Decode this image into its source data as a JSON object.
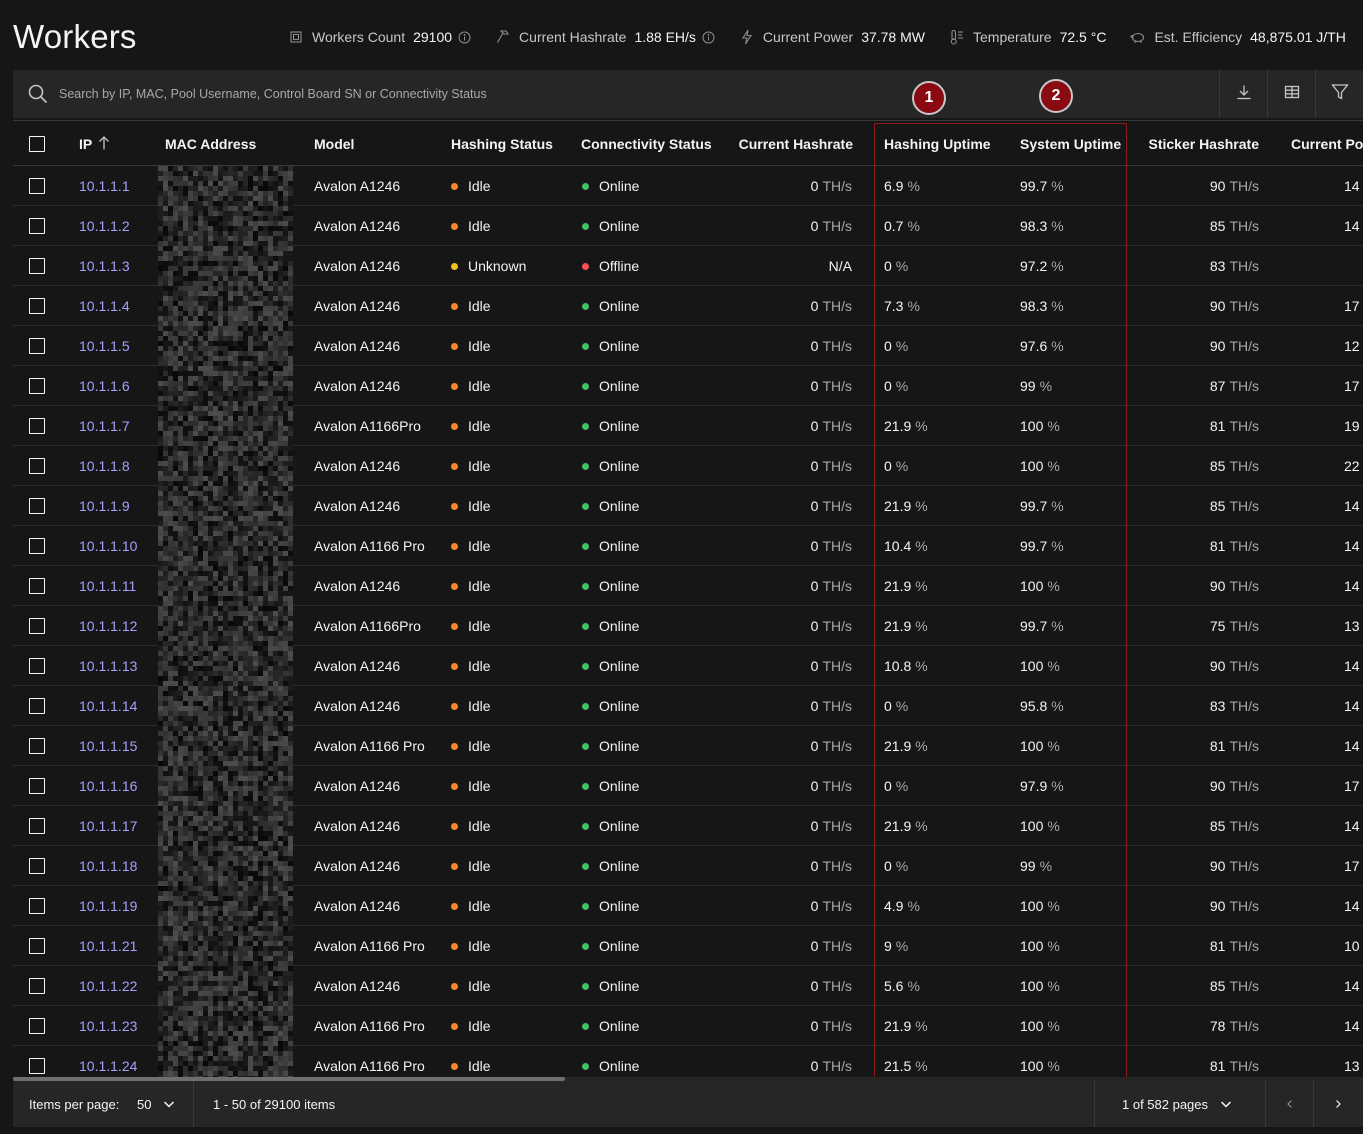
{
  "page": {
    "title": "Workers"
  },
  "stats": [
    {
      "icon": "chip-icon",
      "label": "Workers Count",
      "value": "29100",
      "info": true
    },
    {
      "icon": "hammer-icon",
      "label": "Current Hashrate",
      "value": "1.88 EH/s",
      "info": true
    },
    {
      "icon": "lightning-icon",
      "label": "Current Power",
      "value": "37.78 MW",
      "info": false
    },
    {
      "icon": "thermometer-icon",
      "label": "Temperature",
      "value": "72.5 °C",
      "info": false
    },
    {
      "icon": "piggy-bank-icon",
      "label": "Est. Efficiency",
      "value": "48,875.01 J/TH",
      "info": false
    }
  ],
  "search": {
    "placeholder": "Search by IP, MAC, Pool Username, Control Board SN or Connectivity Status"
  },
  "toolbar": {
    "icons": [
      "download-icon",
      "columns-icon",
      "filter-icon"
    ]
  },
  "columns": [
    "IP",
    "MAC Address",
    "Model",
    "Hashing Status",
    "Connectivity Status",
    "Current Hashrate",
    "Hashing Uptime",
    "System Uptime",
    "Sticker Hashrate",
    "Current Power"
  ],
  "sort": {
    "column": "IP",
    "direction": "ascending"
  },
  "annotations": {
    "marker1": "1",
    "marker2": "2"
  },
  "rows": [
    {
      "ip": "10.1.1.1",
      "model": "Avalon A1246",
      "hashing": "Idle",
      "conn": "Online",
      "hashrate": "0",
      "hashrate_unit": "TH/s",
      "hu": "6.9",
      "su": "99.7",
      "sticker": "90",
      "power": "14"
    },
    {
      "ip": "10.1.1.2",
      "model": "Avalon A1246",
      "hashing": "Idle",
      "conn": "Online",
      "hashrate": "0",
      "hashrate_unit": "TH/s",
      "hu": "0.7",
      "su": "98.3",
      "sticker": "85",
      "power": "14"
    },
    {
      "ip": "10.1.1.3",
      "model": "Avalon A1246",
      "hashing": "Unknown",
      "conn": "Offline",
      "hashrate": "N/A",
      "hashrate_unit": "",
      "hu": "0",
      "su": "97.2",
      "sticker": "83",
      "power": ""
    },
    {
      "ip": "10.1.1.4",
      "model": "Avalon A1246",
      "hashing": "Idle",
      "conn": "Online",
      "hashrate": "0",
      "hashrate_unit": "TH/s",
      "hu": "7.3",
      "su": "98.3",
      "sticker": "90",
      "power": "17"
    },
    {
      "ip": "10.1.1.5",
      "model": "Avalon A1246",
      "hashing": "Idle",
      "conn": "Online",
      "hashrate": "0",
      "hashrate_unit": "TH/s",
      "hu": "0",
      "su": "97.6",
      "sticker": "90",
      "power": "12"
    },
    {
      "ip": "10.1.1.6",
      "model": "Avalon A1246",
      "hashing": "Idle",
      "conn": "Online",
      "hashrate": "0",
      "hashrate_unit": "TH/s",
      "hu": "0",
      "su": "99",
      "sticker": "87",
      "power": "17"
    },
    {
      "ip": "10.1.1.7",
      "model": "Avalon A1166Pro",
      "hashing": "Idle",
      "conn": "Online",
      "hashrate": "0",
      "hashrate_unit": "TH/s",
      "hu": "21.9",
      "su": "100",
      "sticker": "81",
      "power": "19"
    },
    {
      "ip": "10.1.1.8",
      "model": "Avalon A1246",
      "hashing": "Idle",
      "conn": "Online",
      "hashrate": "0",
      "hashrate_unit": "TH/s",
      "hu": "0",
      "su": "100",
      "sticker": "85",
      "power": "22"
    },
    {
      "ip": "10.1.1.9",
      "model": "Avalon A1246",
      "hashing": "Idle",
      "conn": "Online",
      "hashrate": "0",
      "hashrate_unit": "TH/s",
      "hu": "21.9",
      "su": "99.7",
      "sticker": "85",
      "power": "14"
    },
    {
      "ip": "10.1.1.10",
      "model": "Avalon A1166 Pro",
      "hashing": "Idle",
      "conn": "Online",
      "hashrate": "0",
      "hashrate_unit": "TH/s",
      "hu": "10.4",
      "su": "99.7",
      "sticker": "81",
      "power": "14"
    },
    {
      "ip": "10.1.1.11",
      "model": "Avalon A1246",
      "hashing": "Idle",
      "conn": "Online",
      "hashrate": "0",
      "hashrate_unit": "TH/s",
      "hu": "21.9",
      "su": "100",
      "sticker": "90",
      "power": "14"
    },
    {
      "ip": "10.1.1.12",
      "model": "Avalon A1166Pro",
      "hashing": "Idle",
      "conn": "Online",
      "hashrate": "0",
      "hashrate_unit": "TH/s",
      "hu": "21.9",
      "su": "99.7",
      "sticker": "75",
      "power": "13"
    },
    {
      "ip": "10.1.1.13",
      "model": "Avalon A1246",
      "hashing": "Idle",
      "conn": "Online",
      "hashrate": "0",
      "hashrate_unit": "TH/s",
      "hu": "10.8",
      "su": "100",
      "sticker": "90",
      "power": "14"
    },
    {
      "ip": "10.1.1.14",
      "model": "Avalon A1246",
      "hashing": "Idle",
      "conn": "Online",
      "hashrate": "0",
      "hashrate_unit": "TH/s",
      "hu": "0",
      "su": "95.8",
      "sticker": "83",
      "power": "14"
    },
    {
      "ip": "10.1.1.15",
      "model": "Avalon A1166 Pro",
      "hashing": "Idle",
      "conn": "Online",
      "hashrate": "0",
      "hashrate_unit": "TH/s",
      "hu": "21.9",
      "su": "100",
      "sticker": "81",
      "power": "14"
    },
    {
      "ip": "10.1.1.16",
      "model": "Avalon A1246",
      "hashing": "Idle",
      "conn": "Online",
      "hashrate": "0",
      "hashrate_unit": "TH/s",
      "hu": "0",
      "su": "97.9",
      "sticker": "90",
      "power": "17"
    },
    {
      "ip": "10.1.1.17",
      "model": "Avalon A1246",
      "hashing": "Idle",
      "conn": "Online",
      "hashrate": "0",
      "hashrate_unit": "TH/s",
      "hu": "21.9",
      "su": "100",
      "sticker": "85",
      "power": "14"
    },
    {
      "ip": "10.1.1.18",
      "model": "Avalon A1246",
      "hashing": "Idle",
      "conn": "Online",
      "hashrate": "0",
      "hashrate_unit": "TH/s",
      "hu": "0",
      "su": "99",
      "sticker": "90",
      "power": "17"
    },
    {
      "ip": "10.1.1.19",
      "model": "Avalon A1246",
      "hashing": "Idle",
      "conn": "Online",
      "hashrate": "0",
      "hashrate_unit": "TH/s",
      "hu": "4.9",
      "su": "100",
      "sticker": "90",
      "power": "14"
    },
    {
      "ip": "10.1.1.21",
      "model": "Avalon A1166 Pro",
      "hashing": "Idle",
      "conn": "Online",
      "hashrate": "0",
      "hashrate_unit": "TH/s",
      "hu": "9",
      "su": "100",
      "sticker": "81",
      "power": "10"
    },
    {
      "ip": "10.1.1.22",
      "model": "Avalon A1246",
      "hashing": "Idle",
      "conn": "Online",
      "hashrate": "0",
      "hashrate_unit": "TH/s",
      "hu": "5.6",
      "su": "100",
      "sticker": "85",
      "power": "14"
    },
    {
      "ip": "10.1.1.23",
      "model": "Avalon A1166 Pro",
      "hashing": "Idle",
      "conn": "Online",
      "hashrate": "0",
      "hashrate_unit": "TH/s",
      "hu": "21.9",
      "su": "100",
      "sticker": "78",
      "power": "14"
    },
    {
      "ip": "10.1.1.24",
      "model": "Avalon A1166 Pro",
      "hashing": "Idle",
      "conn": "Online",
      "hashrate": "0",
      "hashrate_unit": "TH/s",
      "hu": "21.5",
      "su": "100",
      "sticker": "81",
      "power": "13"
    }
  ],
  "units": {
    "percent": "%",
    "hashrate": "TH/s"
  },
  "pagination": {
    "items_per_page_label": "Items per page:",
    "items_per_page": "50",
    "range": "1 - 50 of 29100 items",
    "pages": "1 of 582 pages"
  }
}
